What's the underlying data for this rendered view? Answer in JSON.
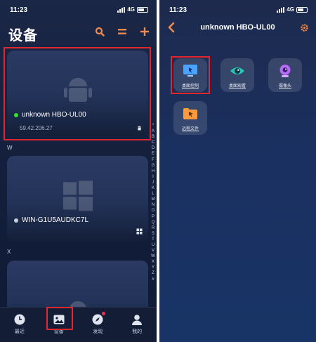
{
  "status": {
    "time": "11:23",
    "network": "4G"
  },
  "devices_screen": {
    "title": "设备",
    "header_icons": [
      "search-icon",
      "menu-icon",
      "plus-icon"
    ],
    "devices": [
      {
        "name": "unknown HBO-UL00",
        "ip": "59.42.206.27",
        "online": true,
        "os": "android"
      },
      {
        "name": "WIN-G1U5AUDKC7L",
        "ip": "",
        "online": false,
        "os": "windows"
      },
      {
        "name": "",
        "ip": "",
        "online": false,
        "os": "android"
      }
    ],
    "sections": [
      "W",
      "X"
    ],
    "alphabet": [
      "*",
      "A",
      "B",
      "C",
      "D",
      "E",
      "F",
      "G",
      "H",
      "I",
      "J",
      "K",
      "L",
      "M",
      "N",
      "O",
      "P",
      "Q",
      "R",
      "S",
      "T",
      "U",
      "V",
      "W",
      "X",
      "Y",
      "Z",
      "#"
    ],
    "tabs": [
      {
        "label": "最近",
        "icon": "clock-icon"
      },
      {
        "label": "设备",
        "icon": "image-icon"
      },
      {
        "label": "发现",
        "icon": "compass-icon"
      },
      {
        "label": "我的",
        "icon": "person-icon"
      }
    ],
    "colors": {
      "accent": "#f28a4d",
      "online": "#2ee62e",
      "highlight": "#e0262e"
    }
  },
  "device_detail": {
    "title": "unknown HBO-UL00",
    "functions": [
      {
        "label": "桌面控制",
        "icon": "remote-control-icon"
      },
      {
        "label": "桌面观看",
        "icon": "eye-icon"
      },
      {
        "label": "摄像头",
        "icon": "webcam-icon"
      },
      {
        "label": "远程文件",
        "icon": "folder-icon"
      }
    ]
  }
}
